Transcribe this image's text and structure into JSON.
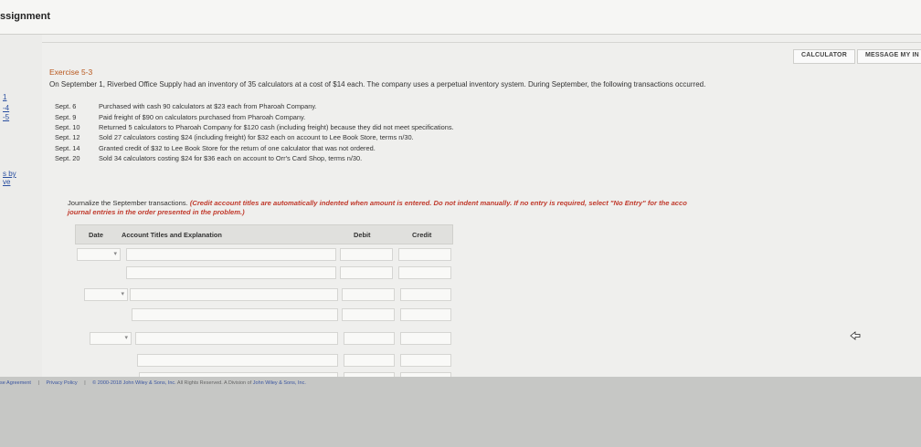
{
  "header": {
    "title": "ssignment"
  },
  "left_nav": {
    "links": [
      "1",
      "-4",
      "-5",
      "s by",
      "ve"
    ]
  },
  "toolbar": {
    "calculator_label": "CALCULATOR",
    "message_label": "MESSAGE MY IN"
  },
  "exercise": {
    "title": "Exercise 5-3",
    "intro": "On September 1, Riverbed Office Supply had an inventory of 35 calculators at a cost of $14 each. The company uses a perpetual inventory system. During September, the following transactions occurred.",
    "transactions": [
      {
        "date": "Sept. 6",
        "text": "Purchased with cash 90 calculators at $23 each from Pharoah Company."
      },
      {
        "date": "Sept. 9",
        "text": "Paid freight of $90 on calculators purchased from Pharoah Company."
      },
      {
        "date": "Sept. 10",
        "text": "Returned 5 calculators to Pharoah Company for $120 cash (including freight) because they did not meet specifications."
      },
      {
        "date": "Sept. 12",
        "text": "Sold 27 calculators costing $24 (including freight) for $32 each on account to Lee Book Store, terms n/30."
      },
      {
        "date": "Sept. 14",
        "text": "Granted credit of $32 to Lee Book Store for the return of one calculator that was not ordered."
      },
      {
        "date": "Sept. 20",
        "text": "Sold 34 calculators costing $24 for $36 each on account to Orr's Card Shop, terms n/30."
      }
    ],
    "instruction_plain": "Journalize the September transactions.",
    "instruction_red_1": "(Credit account titles are automatically indented when amount is entered. Do not indent manually. If no entry is required, select \"No Entry\" for the acco",
    "instruction_red_2": "journal entries in the order presented in the problem.)"
  },
  "journal": {
    "col_date": "Date",
    "col_account": "Account Titles and Explanation",
    "col_debit": "Debit",
    "col_credit": "Credit"
  },
  "footer": {
    "agreement": "se Agreement",
    "sep1": "|",
    "privacy": "Privacy Policy",
    "sep2": "|",
    "copyright": "© 2000-2018 John Wiley & Sons, Inc.",
    "rights": "All Rights Reserved. A Division of",
    "company": "John Wiley & Sons, Inc."
  }
}
